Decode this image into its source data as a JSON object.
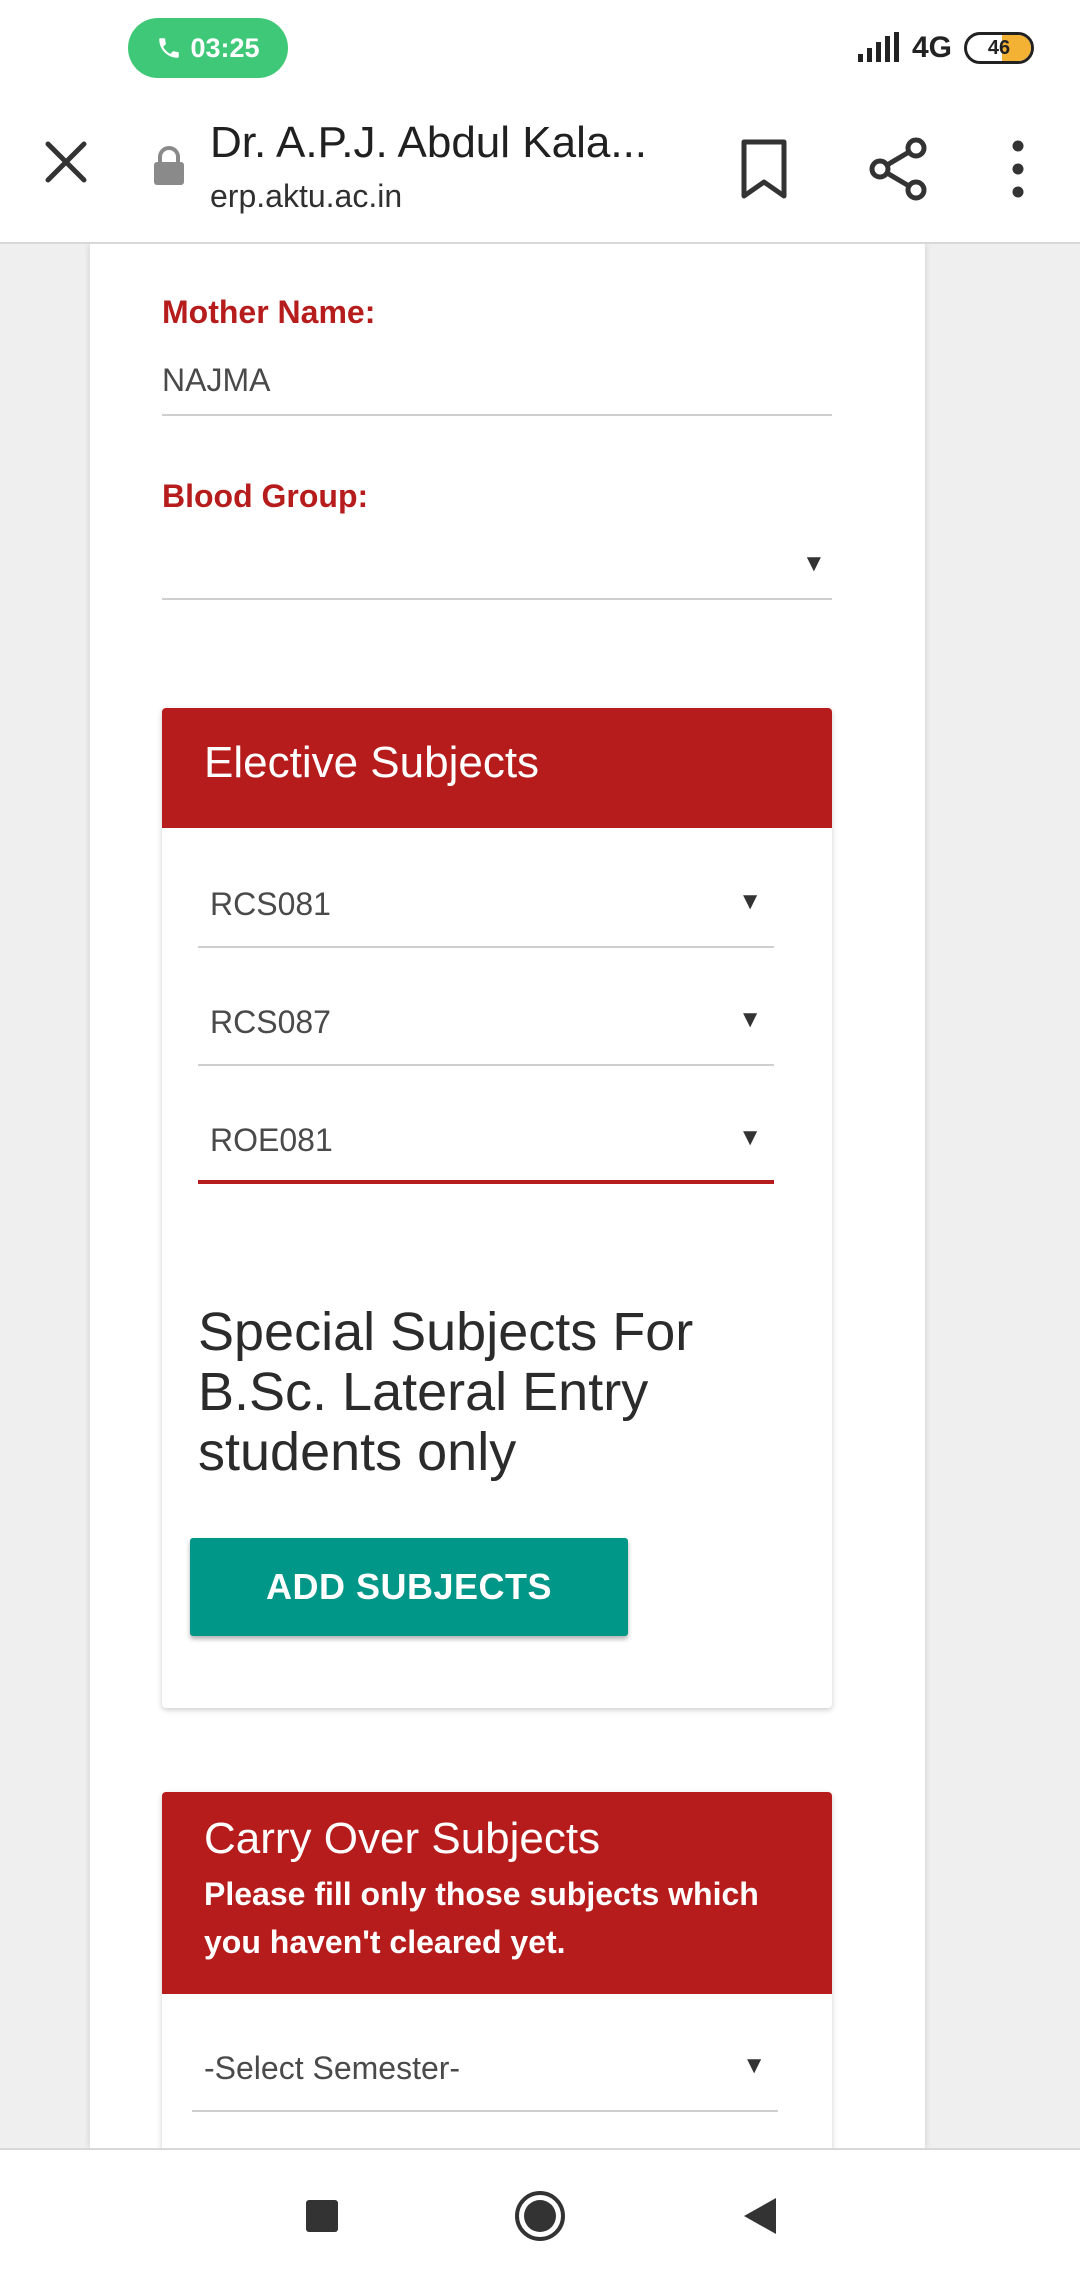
{
  "status_bar": {
    "time": "03:25",
    "network": "4G",
    "battery_level": "46",
    "battery_fraction": 0.46,
    "call_color": "#3ec878"
  },
  "browser": {
    "page_title": "Dr. A.P.J. Abdul Kala...",
    "url": "erp.aktu.ac.in",
    "icons": [
      "close-icon",
      "lock-icon",
      "bookmark-icon",
      "share-icon",
      "more-vert-icon"
    ]
  },
  "form": {
    "mother_name_label": "Mother Name:",
    "mother_name_value": "NAJMA",
    "blood_group_label": "Blood Group:",
    "blood_group_value": ""
  },
  "elective": {
    "title": "Elective Subjects",
    "selects": [
      "RCS081",
      "RCS087",
      "ROE081"
    ],
    "special_text": "Special Subjects For B.Sc. Lateral Entry students only",
    "add_button_label": "ADD SUBJECTS"
  },
  "carry_over": {
    "title": "Carry Over Subjects",
    "subtitle": "Please fill only those subjects which you haven't cleared yet.",
    "semester_placeholder": "-Select Semester-"
  },
  "colors": {
    "accent_red": "#b71c1c",
    "button_teal": "#009688"
  },
  "nav": {
    "icons": [
      "recents-square-icon",
      "home-circle-icon",
      "back-triangle-icon"
    ]
  }
}
